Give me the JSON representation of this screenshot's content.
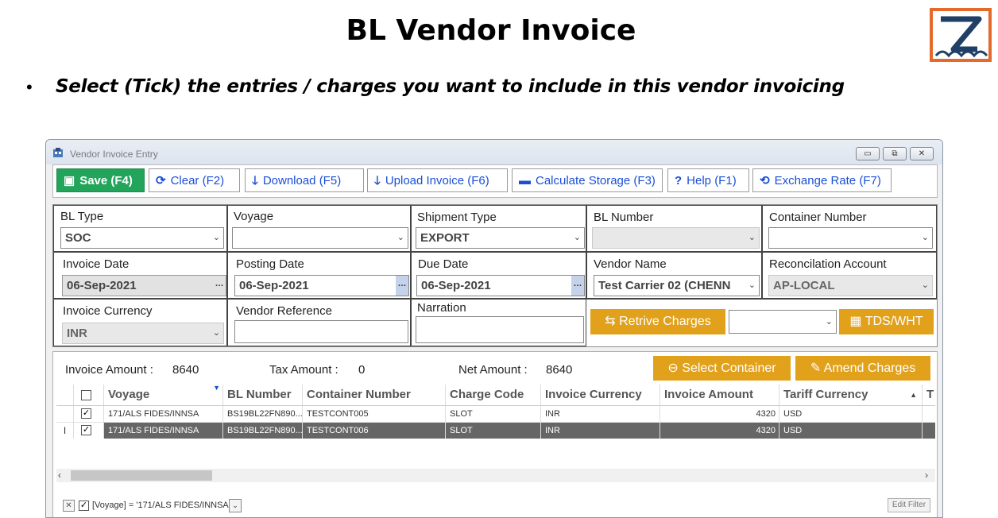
{
  "slide": {
    "title": "BL Vendor Invoice",
    "bullet": "•",
    "instruction": "Select (Tick) the entries  / charges you want to include in this vendor invoicing"
  },
  "window": {
    "title": "Vendor Invoice Entry",
    "minimize": "▭",
    "maximize": "⧉",
    "close": "✕"
  },
  "toolbar": {
    "save": "Save (F4)",
    "clear": "Clear (F2)",
    "download": "Download (F5)",
    "upload": "Upload Invoice (F6)",
    "calc_storage": "Calculate Storage (F3)",
    "help": "Help (F1)",
    "exchange": "Exchange Rate (F7)"
  },
  "form": {
    "bl_type": {
      "label": "BL Type",
      "value": "SOC"
    },
    "voyage": {
      "label": "Voyage",
      "value": ""
    },
    "shipment_type": {
      "label": "Shipment Type",
      "value": "EXPORT"
    },
    "bl_number": {
      "label": "BL Number",
      "value": ""
    },
    "container_number": {
      "label": "Container Number",
      "value": ""
    },
    "invoice_date": {
      "label": "Invoice Date",
      "value": "06-Sep-2021"
    },
    "posting_date": {
      "label": "Posting Date",
      "value": "06-Sep-2021"
    },
    "due_date": {
      "label": "Due Date",
      "value": "06-Sep-2021"
    },
    "vendor_name": {
      "label": "Vendor Name",
      "value": "Test Carrier 02 (CHENN"
    },
    "recon_account": {
      "label": "Reconcilation Account",
      "value": "AP-LOCAL"
    },
    "invoice_currency": {
      "label": "Invoice Currency",
      "value": "INR"
    },
    "vendor_reference": {
      "label": "Vendor Reference",
      "value": ""
    },
    "narration": {
      "label": "Narration",
      "value": ""
    },
    "retrive_charges": "Retrive Charges",
    "tds_wht": "TDS/WHT"
  },
  "summary": {
    "invoice_amount_label": "Invoice Amount :",
    "invoice_amount": "8640",
    "tax_amount_label": "Tax Amount :",
    "tax_amount": "0",
    "net_amount_label": "Net Amount :",
    "net_amount": "8640",
    "select_container": "Select Container",
    "amend_charges": "Amend Charges"
  },
  "grid": {
    "columns": [
      "Voyage",
      "BL Number",
      "Container Number",
      "Charge Code",
      "Invoice Currency",
      "Invoice Amount",
      "Tariff Currency",
      "T"
    ],
    "rows": [
      {
        "checked": "✓",
        "voyage": "171/ALS FIDES/INNSA",
        "bl": "BS19BL22FN890...",
        "container": "TESTCONT005",
        "charge": "SLOT",
        "inv_cur": "INR",
        "inv_amt": "4320",
        "tariff_cur": "USD"
      },
      {
        "checked": "✓",
        "voyage": "171/ALS FIDES/INNSA",
        "bl": "BS19BL22FN890...",
        "container": "TESTCONT006",
        "charge": "SLOT",
        "inv_cur": "INR",
        "inv_amt": "4320",
        "tariff_cur": "USD"
      }
    ],
    "row_indicator": "I",
    "filter_text": "[Voyage] = '171/ALS FIDES/INNSA'",
    "filter_check": "✓",
    "edit_filter": "Edit Filter"
  },
  "colors": {
    "save_green": "#22a55a",
    "action_orange": "#e2a11b",
    "toolbar_blue": "#1a4fd6",
    "selected_row": "#666666"
  }
}
